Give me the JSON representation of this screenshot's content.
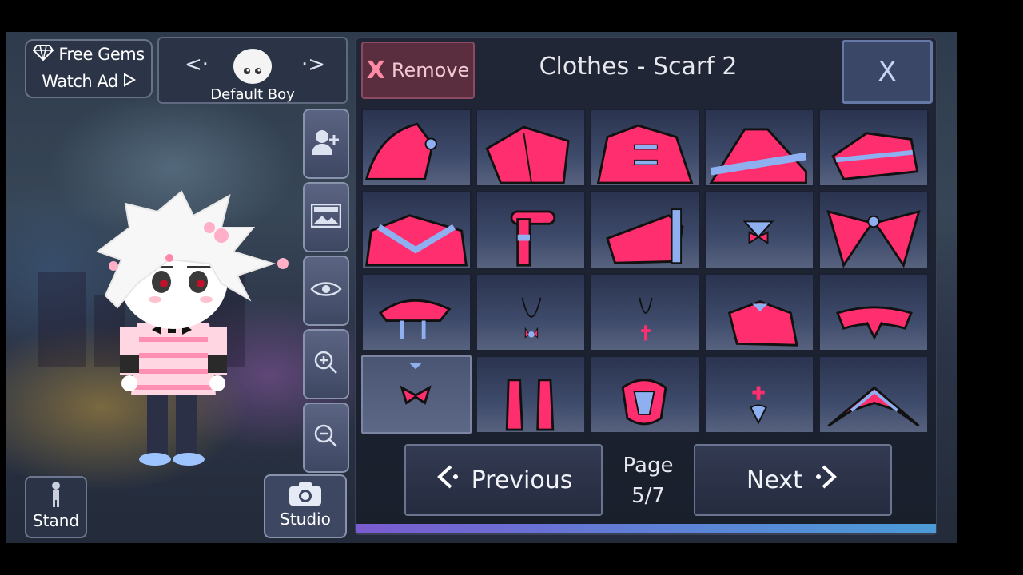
{
  "gems_widget": {
    "line1": "Free Gems",
    "line2": "Watch Ad"
  },
  "preset": {
    "name": "Default Boy"
  },
  "side_buttons": [
    "add-character-icon",
    "background-image-icon",
    "eye-icon",
    "zoom-in-icon",
    "zoom-out-icon"
  ],
  "stand_button": {
    "label": "Stand"
  },
  "studio_button": {
    "label": "Studio"
  },
  "panel": {
    "remove_label": "Remove",
    "title": "Clothes - Scarf 2",
    "close_label": "X",
    "previous_label": "Previous",
    "next_label": "Next",
    "page_label": "Page",
    "page_value": "5/7",
    "selected_index": 15,
    "items": [
      "scarf-item-1",
      "scarf-item-2",
      "scarf-item-3",
      "scarf-item-4",
      "scarf-item-5",
      "scarf-item-6",
      "scarf-item-7",
      "scarf-item-8",
      "scarf-item-9",
      "scarf-item-10",
      "scarf-item-11",
      "scarf-item-12",
      "scarf-item-13",
      "scarf-item-14",
      "scarf-item-15",
      "scarf-item-16",
      "scarf-item-17",
      "scarf-item-18",
      "scarf-item-19",
      "scarf-item-20"
    ]
  },
  "colors": {
    "item_pink": "#ff2e6e",
    "item_blue": "#8fb0f0",
    "panel_bg": "#1d2231"
  }
}
